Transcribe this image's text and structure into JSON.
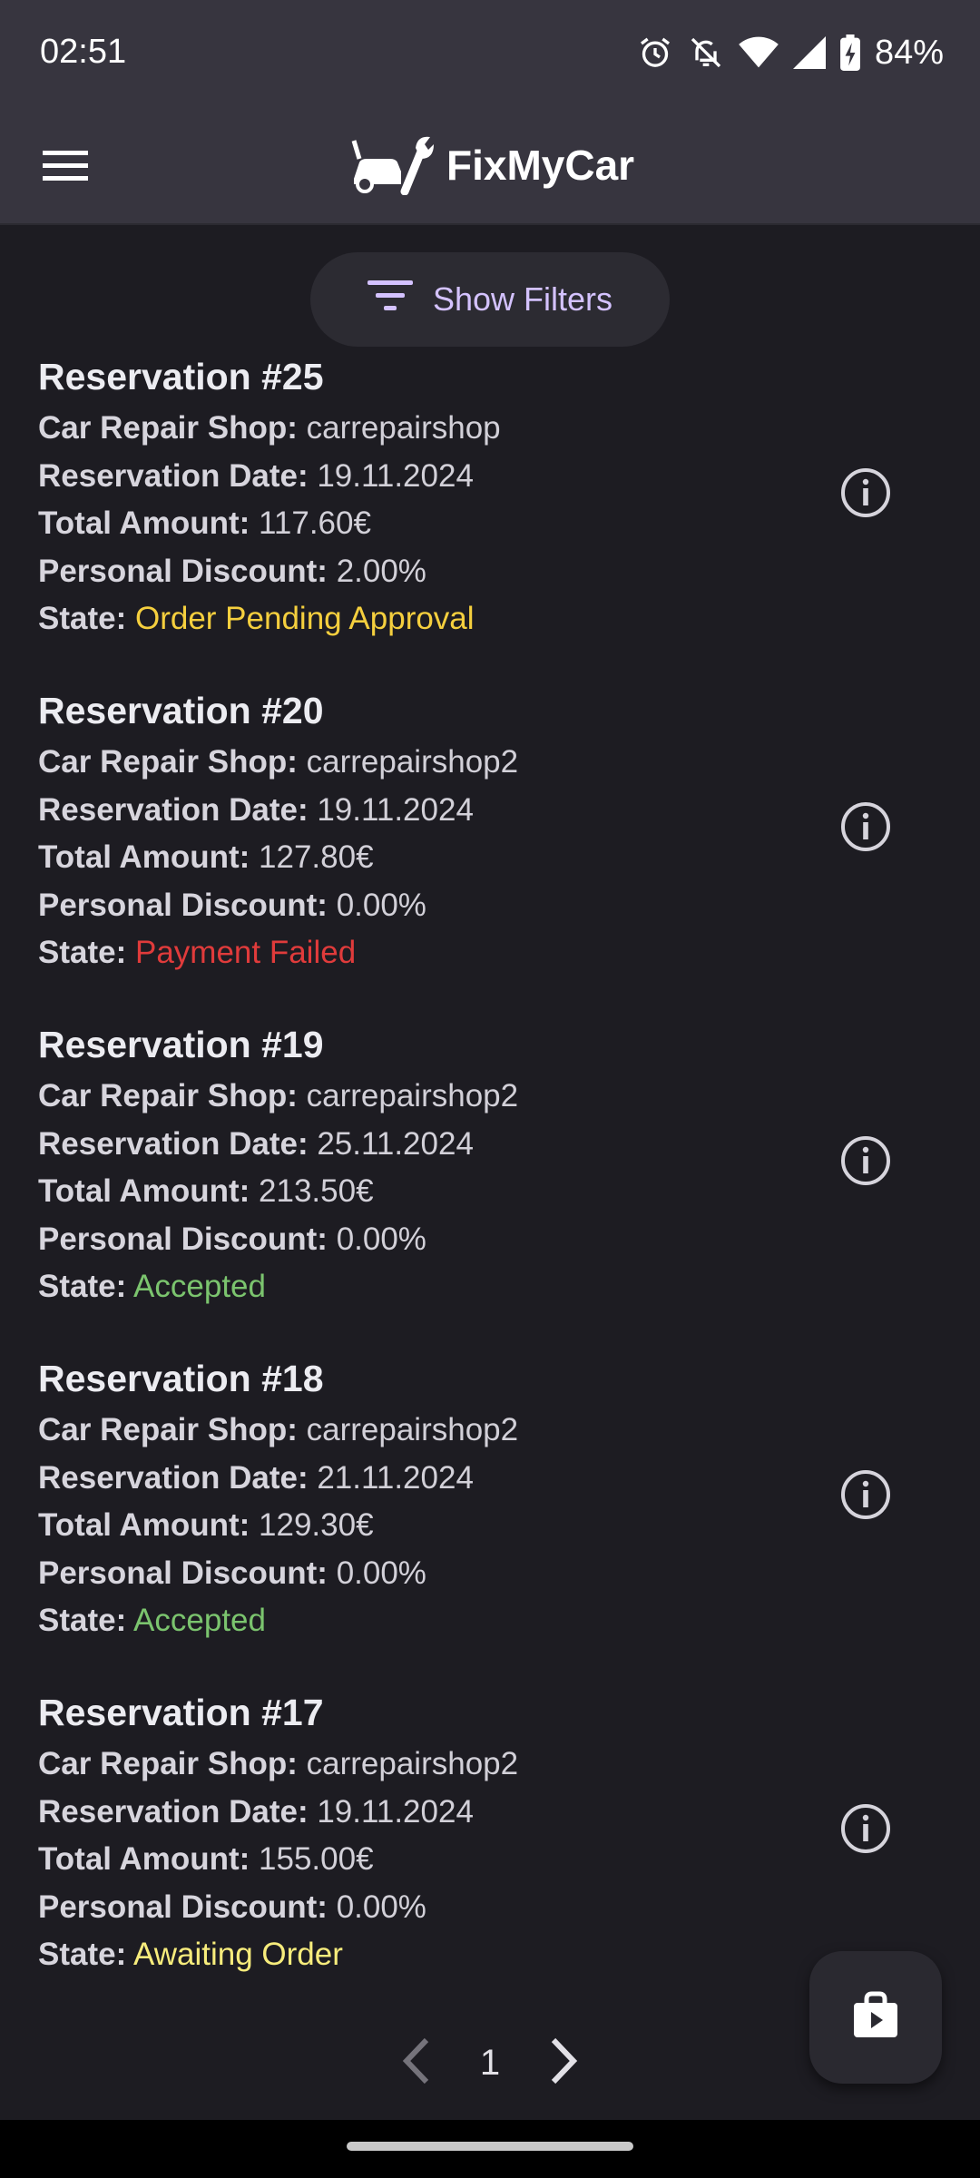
{
  "status_bar": {
    "time": "02:51",
    "battery": "84%",
    "icons": [
      "alarm-icon",
      "notifications-off-icon",
      "wifi-icon",
      "signal-icon",
      "battery-charging-icon"
    ]
  },
  "app_bar": {
    "menu_icon": "hamburger-menu-icon",
    "logo_icon": "car-wrench-logo",
    "title": "FixMyCar"
  },
  "filters": {
    "icon": "filter-list-icon",
    "label": "Show Filters"
  },
  "colors": {
    "order_pending": "#f5cf3e",
    "payment_failed": "#e03b3b",
    "accepted": "#7bc46e",
    "awaiting_order": "#f7ec7c",
    "accent": "#d4c2ff"
  },
  "reservations": [
    {
      "title": "Reservation #25",
      "shop_label": "Car Repair Shop:",
      "shop": "carrepairshop",
      "date_label": "Reservation Date:",
      "date": "19.11.2024",
      "amount_label": "Total Amount:",
      "amount": "117.60€",
      "discount_label": "Personal Discount:",
      "discount": "2.00%",
      "state_label": "State:",
      "state": "Order Pending Approval"
    },
    {
      "title": "Reservation #20",
      "shop_label": "Car Repair Shop:",
      "shop": "carrepairshop2",
      "date_label": "Reservation Date:",
      "date": "19.11.2024",
      "amount_label": "Total Amount:",
      "amount": "127.80€",
      "discount_label": "Personal Discount:",
      "discount": "0.00%",
      "state_label": "State:",
      "state": "Payment Failed"
    },
    {
      "title": "Reservation #19",
      "shop_label": "Car Repair Shop:",
      "shop": "carrepairshop2",
      "date_label": "Reservation Date:",
      "date": "25.11.2024",
      "amount_label": "Total Amount:",
      "amount": "213.50€",
      "discount_label": "Personal Discount:",
      "discount": "0.00%",
      "state_label": "State:",
      "state": "Accepted"
    },
    {
      "title": "Reservation #18",
      "shop_label": "Car Repair Shop:",
      "shop": "carrepairshop2",
      "date_label": "Reservation Date:",
      "date": "21.11.2024",
      "amount_label": "Total Amount:",
      "amount": "129.30€",
      "discount_label": "Personal Discount:",
      "discount": "0.00%",
      "state_label": "State:",
      "state": "Accepted"
    },
    {
      "title": "Reservation #17",
      "shop_label": "Car Repair Shop:",
      "shop": "carrepairshop2",
      "date_label": "Reservation Date:",
      "date": "19.11.2024",
      "amount_label": "Total Amount:",
      "amount": "155.00€",
      "discount_label": "Personal Discount:",
      "discount": "0.00%",
      "state_label": "State:",
      "state": "Awaiting Order"
    }
  ],
  "pagination": {
    "page": "1",
    "prev_icon": "chevron-left-icon",
    "next_icon": "chevron-right-icon"
  },
  "fab": {
    "icon": "shopping-bag-icon"
  }
}
